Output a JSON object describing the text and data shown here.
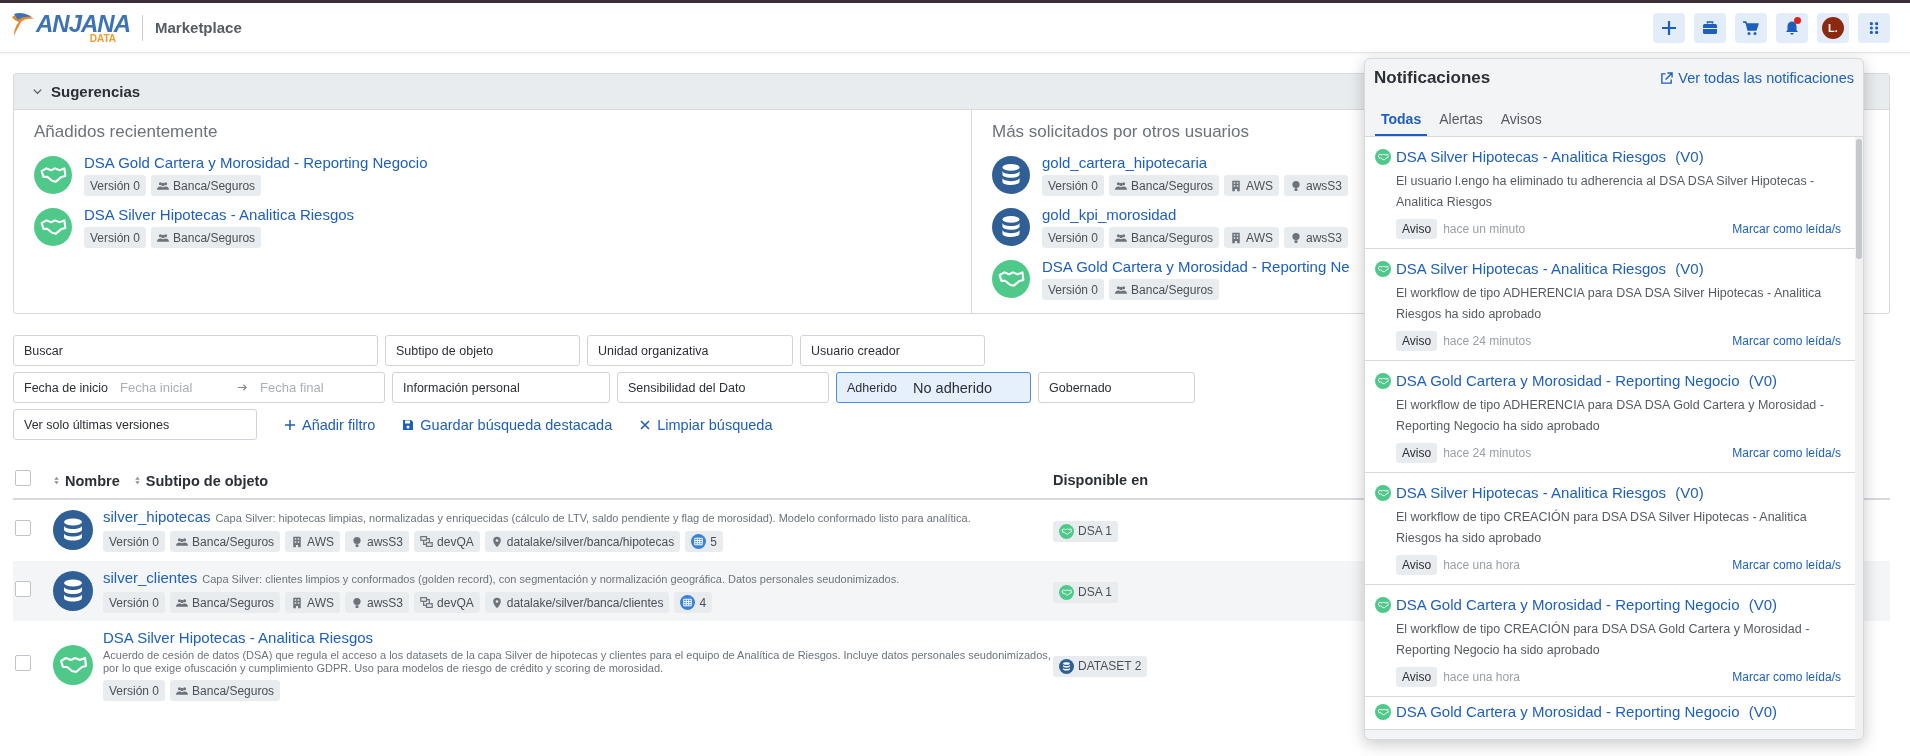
{
  "header": {
    "logo_text": "ANJANA",
    "logo_subtext": "DATA",
    "section": "Marketplace",
    "avatar": "L.",
    "unread_notifications": true
  },
  "suggestions": {
    "title": "Sugerencias",
    "expanded": true,
    "recent": {
      "title": "Añadidos recientemente",
      "items": [
        {
          "kind": "dsa",
          "title": "DSA Gold Cartera y Morosidad - Reporting Negocio",
          "tags": [
            {
              "kind": "version",
              "text": "Versión 0"
            },
            {
              "kind": "group",
              "text": "Banca/Seguros"
            }
          ]
        },
        {
          "kind": "dsa",
          "title": "DSA Silver Hipotecas - Analitica Riesgos",
          "tags": [
            {
              "kind": "version",
              "text": "Versión 0"
            },
            {
              "kind": "group",
              "text": "Banca/Seguros"
            }
          ]
        }
      ]
    },
    "popular": {
      "title": "Más solicitados por otros usuarios",
      "items": [
        {
          "kind": "dataset",
          "title": "gold_cartera_hipotecaria",
          "tags": [
            {
              "kind": "version",
              "text": "Versión 0"
            },
            {
              "kind": "group",
              "text": "Banca/Seguros"
            },
            {
              "kind": "provider",
              "text": "AWS"
            },
            {
              "kind": "storage",
              "text": "awsS3"
            }
          ]
        },
        {
          "kind": "dataset",
          "title": "gold_kpi_morosidad",
          "tags": [
            {
              "kind": "version",
              "text": "Versión 0"
            },
            {
              "kind": "group",
              "text": "Banca/Seguros"
            },
            {
              "kind": "provider",
              "text": "AWS"
            },
            {
              "kind": "storage",
              "text": "awsS3"
            }
          ]
        },
        {
          "kind": "dsa",
          "title": "DSA Gold Cartera y Morosidad - Reporting Ne",
          "tags": [
            {
              "kind": "version",
              "text": "Versión 0"
            },
            {
              "kind": "group",
              "text": "Banca/Seguros"
            }
          ]
        }
      ]
    }
  },
  "filters": [
    [
      {
        "kind": "search",
        "label": "Buscar"
      },
      {
        "kind": "select",
        "label": "Subtipo de objeto"
      },
      {
        "kind": "select",
        "label": "Unidad organizativa"
      },
      {
        "kind": "select",
        "label": "Usuario creador"
      }
    ],
    [
      {
        "kind": "daterange",
        "label": "Fecha de inicio",
        "start_placeholder": "Fecha inicial",
        "end_placeholder": "Fecha final"
      },
      {
        "kind": "select",
        "label": "Información personal"
      },
      {
        "kind": "select",
        "label": "Sensibilidad del Dato"
      },
      {
        "kind": "select",
        "label": "Adherido",
        "value": "No adherido",
        "active": true
      },
      {
        "kind": "select",
        "label": "Gobernado"
      }
    ],
    [
      {
        "kind": "select",
        "label": "Ver solo últimas versiones"
      },
      {
        "kind": "add",
        "label": "Añadir filtro"
      },
      {
        "kind": "save",
        "label": "Guardar búsqueda destacada"
      },
      {
        "kind": "clear",
        "label": "Limpiar búsqueda"
      }
    ]
  ],
  "table": {
    "select_all": {
      "checked": false
    },
    "columns": [
      {
        "label": "Nombre",
        "sortable": true
      },
      {
        "label": "Subtipo de objeto",
        "sortable": true
      },
      {
        "label": "Disponible en",
        "sortable": false
      }
    ],
    "rows": [
      {
        "kind": "dataset",
        "checked": false,
        "name": "silver_hipotecas",
        "description": "Capa Silver: hipotecas limpias, normalizadas y enriquecidas (cálculo de LTV, saldo pendiente y flag de morosidad). Modelo conformado listo para analítica.",
        "tags": [
          {
            "kind": "version",
            "text": "Versión 0"
          },
          {
            "kind": "group",
            "text": "Banca/Seguros"
          },
          {
            "kind": "provider",
            "text": "AWS"
          },
          {
            "kind": "storage",
            "text": "awsS3"
          },
          {
            "kind": "env",
            "text": "devQA"
          },
          {
            "kind": "path",
            "text": "datalake/silver/banca/hipotecas"
          },
          {
            "kind": "count",
            "text": "5"
          }
        ],
        "available": [
          {
            "kind": "dsa",
            "text": "DSA 1"
          }
        ]
      },
      {
        "kind": "dataset",
        "checked": false,
        "name": "silver_clientes",
        "description": "Capa Silver: clientes limpios y conformados (golden record), con segmentación y normalización geográfica. Datos personales seudonimizados.",
        "tags": [
          {
            "kind": "version",
            "text": "Versión 0"
          },
          {
            "kind": "group",
            "text": "Banca/Seguros"
          },
          {
            "kind": "provider",
            "text": "AWS"
          },
          {
            "kind": "storage",
            "text": "awsS3"
          },
          {
            "kind": "env",
            "text": "devQA"
          },
          {
            "kind": "path",
            "text": "datalake/silver/banca/clientes"
          },
          {
            "kind": "count",
            "text": "4"
          }
        ],
        "available": [
          {
            "kind": "dsa",
            "text": "DSA 1"
          }
        ]
      },
      {
        "kind": "dsa",
        "checked": false,
        "name": "DSA Silver Hipotecas - Analitica Riesgos",
        "description": "Acuerdo de cesión de datos (DSA) que regula el acceso a los datasets de la capa Silver de hipotecas y clientes para el equipo de Analítica de Riesgos. Incluye datos personales seudonimizados, por lo que exige ofuscación y cumplimiento GDPR. Uso para modelos de riesgo de crédito y scoring de morosidad.",
        "tags": [
          {
            "kind": "version",
            "text": "Versión 0"
          },
          {
            "kind": "group",
            "text": "Banca/Seguros"
          }
        ],
        "available": [
          {
            "kind": "dataset",
            "text": "DATASET 2"
          }
        ]
      }
    ]
  },
  "notifications": {
    "title": "Notificaciones",
    "link": "Ver todas las notificaciones",
    "tabs": [
      {
        "label": "Todas",
        "selected": true
      },
      {
        "label": "Alertas",
        "selected": false
      },
      {
        "label": "Avisos",
        "selected": false
      }
    ],
    "items": [
      {
        "title": "DSA Silver Hipotecas - Analitica Riesgos",
        "version": "(V0)",
        "body": "El usuario l.engo ha eliminado tu adherencia al DSA DSA Silver Hipotecas - Analitica Riesgos",
        "badge": "Aviso",
        "time": "hace un minuto",
        "action": "Marcar como leída/s"
      },
      {
        "title": "DSA Silver Hipotecas - Analitica Riesgos",
        "version": "(V0)",
        "body": "El workflow de tipo ADHERENCIA para DSA DSA Silver Hipotecas - Analitica Riesgos ha sido aprobado",
        "badge": "Aviso",
        "time": "hace 24 minutos",
        "action": "Marcar como leída/s"
      },
      {
        "title": "DSA Gold Cartera y Morosidad - Reporting Negocio",
        "version": "(V0)",
        "body": "El workflow de tipo ADHERENCIA para DSA DSA Gold Cartera y Morosidad - Reporting Negocio ha sido aprobado",
        "badge": "Aviso",
        "time": "hace 24 minutos",
        "action": "Marcar como leída/s"
      },
      {
        "title": "DSA Silver Hipotecas - Analitica Riesgos",
        "version": "(V0)",
        "body": "El workflow de tipo CREACIÓN para DSA DSA Silver Hipotecas - Analitica Riesgos ha sido aprobado",
        "badge": "Aviso",
        "time": "hace una hora",
        "action": "Marcar como leída/s"
      },
      {
        "title": "DSA Gold Cartera y Morosidad - Reporting Negocio",
        "version": "(V0)",
        "body": "El workflow de tipo CREACIÓN para DSA DSA Gold Cartera y Morosidad - Reporting Negocio ha sido aprobado",
        "badge": "Aviso",
        "time": "hace una hora",
        "action": "Marcar como leída/s"
      },
      {
        "title": "DSA Gold Cartera y Morosidad - Reporting Negocio",
        "version": "(V0)"
      }
    ]
  }
}
